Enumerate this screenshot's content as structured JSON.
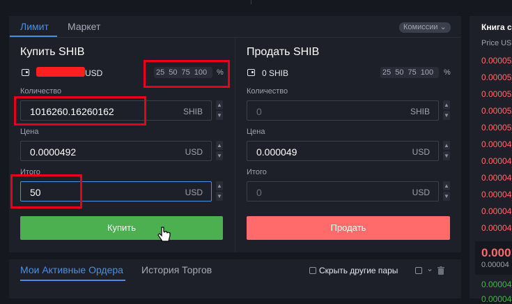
{
  "tabs": {
    "limit": "Лимит",
    "market": "Маркет",
    "commission": "Комиссии"
  },
  "buy": {
    "title": "Купить SHIB",
    "balance_currency": "USD",
    "percentages": [
      "25",
      "50",
      "75",
      "100"
    ],
    "percent_sign": "%",
    "quantity_label": "Количество",
    "quantity_value": "1016260.16260162",
    "quantity_unit": "SHIB",
    "price_label": "Цена",
    "price_value": "0.0000492",
    "price_unit": "USD",
    "total_label": "Итого",
    "total_value": "50",
    "total_unit": "USD",
    "button_label": "Купить"
  },
  "sell": {
    "title": "Продать SHIB",
    "balance": "0 SHIB",
    "percentages": [
      "25",
      "50",
      "75",
      "100"
    ],
    "percent_sign": "%",
    "quantity_label": "Количество",
    "quantity_placeholder": "0",
    "quantity_unit": "SHIB",
    "price_label": "Цена",
    "price_value": "0.000049",
    "price_unit": "USD",
    "total_label": "Итого",
    "total_placeholder": "0",
    "total_unit": "USD",
    "button_label": "Продать"
  },
  "bottom_tabs": {
    "active_orders": "Мои Активные Ордера",
    "trade_history": "История Торгов",
    "hide_other_pairs": "Скрыть другие пары"
  },
  "order_book": {
    "title": "Книга с",
    "price_header": "Price USI",
    "asks": [
      "0.00005",
      "0.00005",
      "0.00005",
      "0.00005",
      "0.00005",
      "0.00004",
      "0.00004",
      "0.00004",
      "0.00004",
      "0.00004",
      "0.00004",
      "0.00004"
    ],
    "mid_price": "0.000",
    "mid_sub": "0.00004",
    "bids": [
      "0.00004",
      "0.00004"
    ]
  },
  "colors": {
    "accent": "#4a90e2",
    "buy": "#4caf50",
    "sell": "#ff6b6b",
    "highlight": "#e8001c"
  }
}
